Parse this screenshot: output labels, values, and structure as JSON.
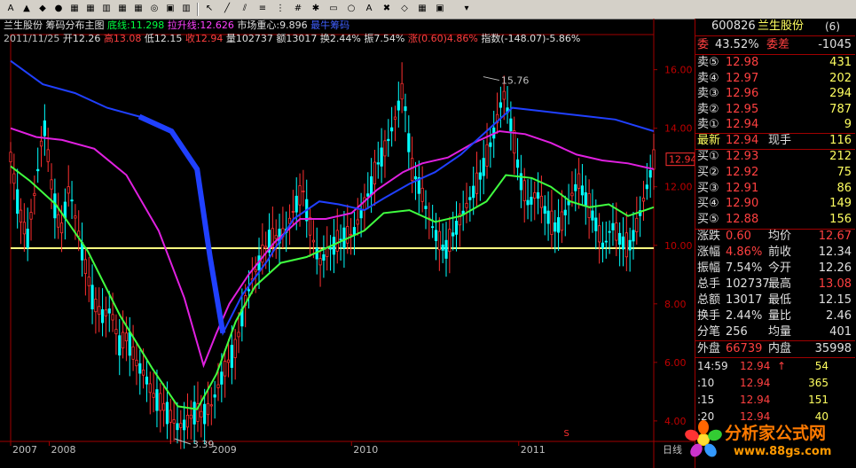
{
  "toolbar": {
    "icons": [
      "cursor-icon",
      "trend-line-icon",
      "parallel-line-icon",
      "channel-icon",
      "fibonacci-icon",
      "grid-icon",
      "gann-icon",
      "rectangle-icon",
      "circle-icon",
      "text-icon",
      "trash-icon",
      "eraser-icon",
      "color-icon",
      "box-icon",
      "save-icon"
    ]
  },
  "header": {
    "stock_name": "兰生股份",
    "view_name": "筹码分布主图",
    "bottom_line_label": "底线:11.298",
    "lift_line_label": "拉升线:12.626",
    "center_label": "市场重心:9.896",
    "extra_label": "最牛筹码"
  },
  "bar_info": {
    "date": "2011/11/25",
    "open": "开12.26",
    "high": "高13.08",
    "low": "低12.15",
    "close": "收12.94",
    "volume": "量102737",
    "amount": "额13017",
    "turnover": "换2.44%",
    "amplitude": "振7.54%",
    "change_label": "涨",
    "change": "(0.60)4.86%",
    "index": "指数",
    "index_change": "(-148.07)-5.86%"
  },
  "chart_data": {
    "type": "line",
    "title": "",
    "xlabel": "",
    "ylabel": "",
    "ylim": [
      3.3,
      17.2
    ],
    "y_ticks": [
      "16.00",
      "14.00",
      "12.00",
      "10.00",
      "8.00",
      "6.00",
      "4.00"
    ],
    "y_tick_values": [
      16,
      14,
      12,
      10,
      8,
      6,
      4
    ],
    "x_ticks": [
      "2007",
      "2008",
      "2009",
      "2010",
      "2011",
      "日线"
    ],
    "x_tick_positions": [
      0.0,
      0.06,
      0.31,
      0.53,
      0.79,
      1.0
    ],
    "current_price_label": "12.94",
    "current_price": 12.94,
    "horizontal_line": 9.9,
    "annotations": [
      {
        "text": "15.76",
        "t": 0.735,
        "value": 15.76
      },
      {
        "text": "3.39",
        "t": 0.255,
        "value": 3.39
      }
    ],
    "marker": "S",
    "series": [
      {
        "name": "",
        "color": "#40ff40",
        "t": [
          0.0,
          0.03,
          0.07,
          0.12,
          0.17,
          0.22,
          0.26,
          0.29,
          0.32,
          0.35,
          0.38,
          0.42,
          0.46,
          0.5,
          0.55,
          0.58,
          0.62,
          0.66,
          0.7,
          0.74,
          0.77,
          0.81,
          0.84,
          0.87,
          0.9,
          0.93,
          0.96,
          1.0
        ],
        "values": [
          12.7,
          12.2,
          11.4,
          9.8,
          7.6,
          5.8,
          4.5,
          4.4,
          5.6,
          7.4,
          8.6,
          9.4,
          9.6,
          10.0,
          10.5,
          11.1,
          11.2,
          10.8,
          11.0,
          11.5,
          12.4,
          12.3,
          12.0,
          11.5,
          11.3,
          11.4,
          11.0,
          11.3
        ]
      },
      {
        "name": "",
        "color": "#e020e0",
        "t": [
          0.0,
          0.04,
          0.08,
          0.13,
          0.18,
          0.23,
          0.27,
          0.3,
          0.32,
          0.34,
          0.37,
          0.41,
          0.45,
          0.49,
          0.53,
          0.57,
          0.61,
          0.64,
          0.68,
          0.72,
          0.76,
          0.8,
          0.84,
          0.88,
          0.92,
          0.96,
          1.0
        ],
        "values": [
          14.0,
          13.7,
          13.6,
          13.3,
          12.4,
          10.5,
          8.2,
          5.9,
          7.0,
          8.0,
          9.0,
          10.1,
          10.9,
          10.9,
          11.1,
          11.9,
          12.5,
          12.8,
          13.0,
          13.5,
          13.9,
          13.8,
          13.5,
          13.1,
          12.9,
          12.8,
          12.6
        ]
      },
      {
        "name": "",
        "color": "#2040ff",
        "t": [
          0.0,
          0.05,
          0.1,
          0.15,
          0.2,
          0.25,
          0.29,
          0.31,
          0.33,
          0.36,
          0.4,
          0.44,
          0.48,
          0.51,
          0.55,
          0.58,
          0.62,
          0.66,
          0.7,
          0.74,
          0.78,
          0.82,
          0.86,
          0.9,
          0.94,
          0.97,
          1.0
        ],
        "values": [
          16.3,
          15.5,
          15.2,
          14.7,
          14.4,
          13.9,
          12.6,
          9.6,
          7.0,
          8.3,
          9.5,
          10.9,
          11.5,
          11.4,
          11.2,
          11.6,
          12.1,
          12.5,
          13.1,
          13.9,
          14.7,
          14.6,
          14.5,
          14.4,
          14.3,
          14.1,
          13.9
        ]
      }
    ],
    "candles_close": [
      13.0,
      11.2,
      10.2,
      12.0,
      14.2,
      11.8,
      10.4,
      12.0,
      10.6,
      9.2,
      8.0,
      7.6,
      7.8,
      6.6,
      6.9,
      6.0,
      5.6,
      4.9,
      4.6,
      4.2,
      3.8,
      3.9,
      4.3,
      4.2,
      4.5,
      5.3,
      6.0,
      6.5,
      8.0,
      8.9,
      9.6,
      10.2,
      10.3,
      10.5,
      11.3,
      11.9,
      10.4,
      9.4,
      9.8,
      10.1,
      10.3,
      10.4,
      11.1,
      11.9,
      12.8,
      13.4,
      14.3,
      15.4,
      12.6,
      12.0,
      11.0,
      10.3,
      9.8,
      10.4,
      11.0,
      11.6,
      12.2,
      13.0,
      14.0,
      15.2,
      14.0,
      12.3,
      11.4,
      11.8,
      11.2,
      10.6,
      10.8,
      11.6,
      12.2,
      11.5,
      10.8,
      9.9,
      10.7,
      10.2,
      9.9,
      10.7,
      11.8,
      12.9
    ]
  },
  "panel": {
    "code": "600826",
    "name": "兰生股份",
    "tag": "(6)",
    "weibi_label": "委",
    "weibi_value": "43.52%",
    "weicha_label": "委差",
    "weicha_value": "-1045",
    "asks": [
      {
        "label": "卖⑤",
        "price": "12.98",
        "vol": "431"
      },
      {
        "label": "卖④",
        "price": "12.97",
        "vol": "202"
      },
      {
        "label": "卖③",
        "price": "12.96",
        "vol": "294"
      },
      {
        "label": "卖②",
        "price": "12.95",
        "vol": "787"
      },
      {
        "label": "卖①",
        "price": "12.94",
        "vol": "9"
      }
    ],
    "latest_label": "最新",
    "latest_price": "12.94",
    "current_hand_label": "现手",
    "current_hand": "116",
    "bids": [
      {
        "label": "买①",
        "price": "12.93",
        "vol": "212"
      },
      {
        "label": "买②",
        "price": "12.92",
        "vol": "75"
      },
      {
        "label": "买③",
        "price": "12.91",
        "vol": "86"
      },
      {
        "label": "买④",
        "price": "12.90",
        "vol": "149"
      },
      {
        "label": "买⑤",
        "price": "12.88",
        "vol": "156"
      }
    ],
    "stats": [
      {
        "l1": "涨跌",
        "v1": "0.60",
        "l2": "均价",
        "v2": "12.67",
        "c1": "#ff4040",
        "c2": "#ff4040"
      },
      {
        "l1": "涨幅",
        "v1": "4.86%",
        "l2": "前收",
        "v2": "12.34",
        "c1": "#ff4040",
        "c2": "#e0e0e0"
      },
      {
        "l1": "振幅",
        "v1": "7.54%",
        "l2": "今开",
        "v2": "12.26",
        "c1": "#e0e0e0",
        "c2": "#e0e0e0"
      },
      {
        "l1": "总手",
        "v1": "102737",
        "l2": "最高",
        "v2": "13.08",
        "c1": "#e0e0e0",
        "c2": "#ff4040"
      },
      {
        "l1": "总额",
        "v1": "13017",
        "l2": "最低",
        "v2": "12.15",
        "c1": "#e0e0e0",
        "c2": "#e0e0e0"
      },
      {
        "l1": "换手",
        "v1": "2.44%",
        "l2": "量比",
        "v2": "2.46",
        "c1": "#e0e0e0",
        "c2": "#e0e0e0"
      },
      {
        "l1": "分笔",
        "v1": "256",
        "l2": "均量",
        "v2": "401",
        "c1": "#e0e0e0",
        "c2": "#e0e0e0"
      }
    ],
    "outer_label": "外盘",
    "outer_value": "66739",
    "inner_label": "内盘",
    "inner_value": "35998",
    "ticks": [
      {
        "time": "14:59",
        "price": "12.94",
        "arrow": "↑",
        "vol": "54"
      },
      {
        "time": ":10",
        "price": "12.94",
        "arrow": "",
        "vol": "365"
      },
      {
        "time": ":15",
        "price": "12.94",
        "arrow": "",
        "vol": "151"
      },
      {
        "time": ":20",
        "price": "12.94",
        "arrow": "",
        "vol": "40"
      }
    ]
  },
  "watermark": {
    "text": "分析家公式网",
    "url": "www.88gs.com"
  },
  "colors": {
    "up": "#ff3030",
    "down": "#00ffff",
    "axis": "#a00000",
    "yellow_line": "#ffff80"
  }
}
